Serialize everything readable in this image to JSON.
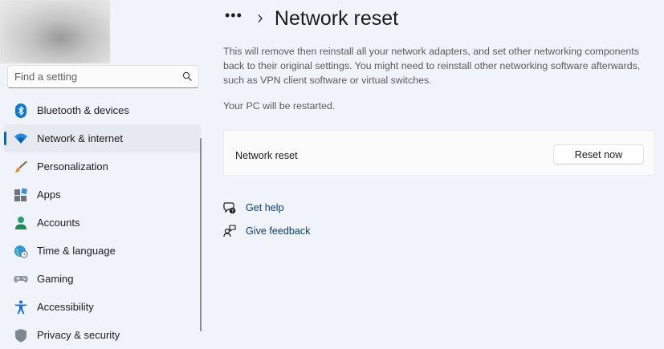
{
  "search": {
    "placeholder": "Find a setting"
  },
  "sidebar": {
    "items": [
      {
        "label": "Bluetooth & devices",
        "icon": "bluetooth-icon",
        "active": false
      },
      {
        "label": "Network & internet",
        "icon": "wifi-icon",
        "active": true
      },
      {
        "label": "Personalization",
        "icon": "brush-icon",
        "active": false
      },
      {
        "label": "Apps",
        "icon": "apps-icon",
        "active": false
      },
      {
        "label": "Accounts",
        "icon": "person-icon",
        "active": false
      },
      {
        "label": "Time & language",
        "icon": "globe-clock-icon",
        "active": false
      },
      {
        "label": "Gaming",
        "icon": "gamepad-icon",
        "active": false
      },
      {
        "label": "Accessibility",
        "icon": "accessibility-icon",
        "active": false
      },
      {
        "label": "Privacy & security",
        "icon": "shield-icon",
        "active": false
      }
    ]
  },
  "header": {
    "more": "•••",
    "title": "Network reset"
  },
  "main": {
    "description": "This will remove then reinstall all your network adapters, and set other networking components back to their original settings. You might need to reinstall other networking software afterwards, such as VPN client software or virtual switches.",
    "restart_note": "Your PC will be restarted.",
    "card": {
      "label": "Network reset",
      "button_label": "Reset now"
    },
    "links": [
      {
        "label": "Get help",
        "icon": "help-icon"
      },
      {
        "label": "Give feedback",
        "icon": "feedback-icon"
      }
    ]
  },
  "colors": {
    "background": "#f0f3f9",
    "accent": "#0067c0",
    "card": "#fbfbfb",
    "link": "#0c3e6b"
  }
}
